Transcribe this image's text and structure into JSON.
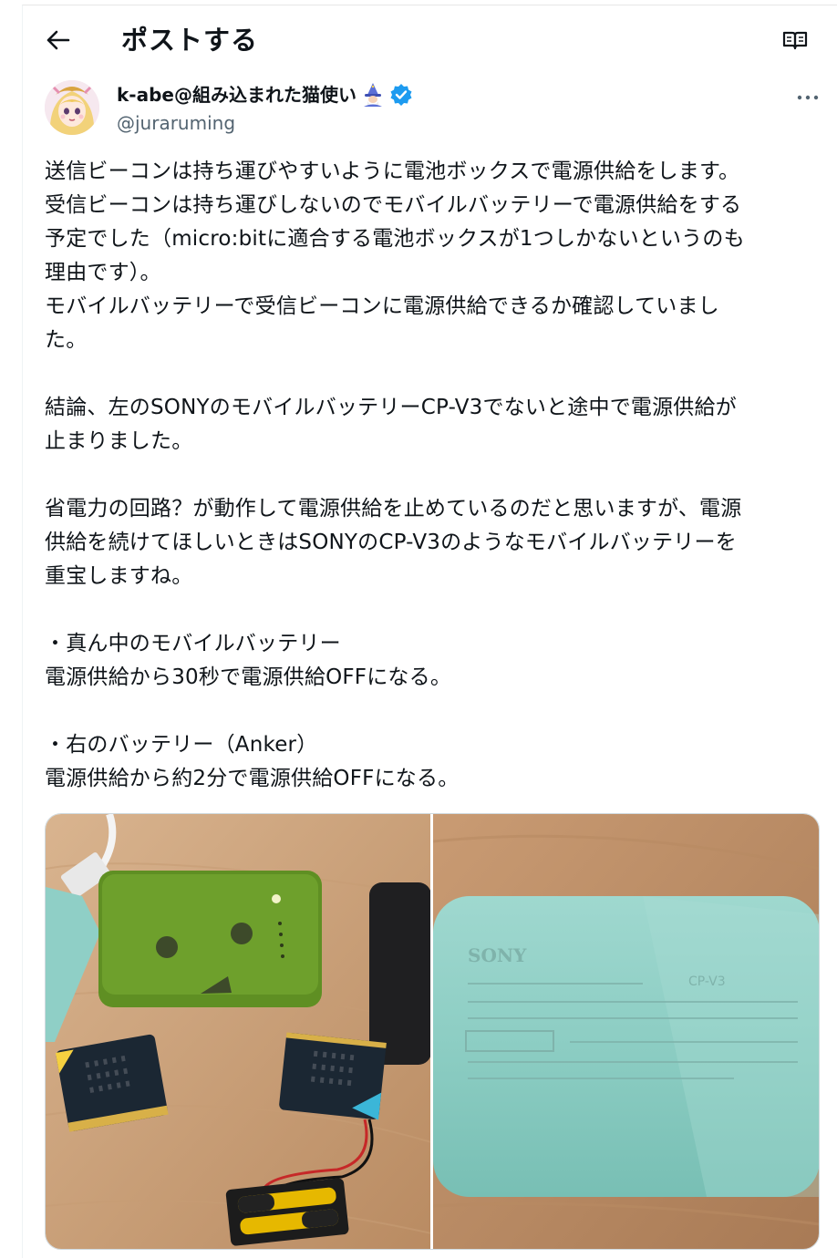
{
  "header": {
    "title": "ポストする",
    "back_icon": "arrow-left-icon",
    "reader_icon": "book-open-icon"
  },
  "author": {
    "name": "k-abe@組み込まれた猫使い",
    "handle": "@juraruming",
    "badge_icon": "verified-badge-icon",
    "emoji_icon": "mage-icon",
    "verified_color": "#1d9bf0"
  },
  "more_icon": "more-dots-icon",
  "post": {
    "lines": [
      "送信ビーコンは持ち運びやすいように電池ボックスで電源供給をします。",
      "受信ビーコンは持ち運びしないのでモバイルバッテリーで電源供給をする",
      "予定でした（micro:bitに適合する電池ボックスが1つしかないというのも",
      "理由です）。",
      "モバイルバッテリーで受信ビーコンに電源供給できるか確認していまし",
      "た。",
      "",
      "結論、左のSONYのモバイルバッテリーCP-V3でないと途中で電源供給が",
      "止まりました。",
      "",
      "省電力の回路？が動作して電源供給を止めているのだと思いますが、電源",
      "供給を続けてほしいときはSONYのCP-V3のようなモバイルバッテリーを",
      "重宝しますね。",
      "",
      "・真ん中のモバイルバッテリー",
      "電源供給から30秒で電源供給OFFになる。",
      "",
      "・右のバッテリー（Anker）",
      "電源供給から約2分で電源供給OFFになる。"
    ]
  },
  "media": {
    "photo2_label": {
      "brand": "SONY",
      "model": "CP-V3"
    }
  }
}
